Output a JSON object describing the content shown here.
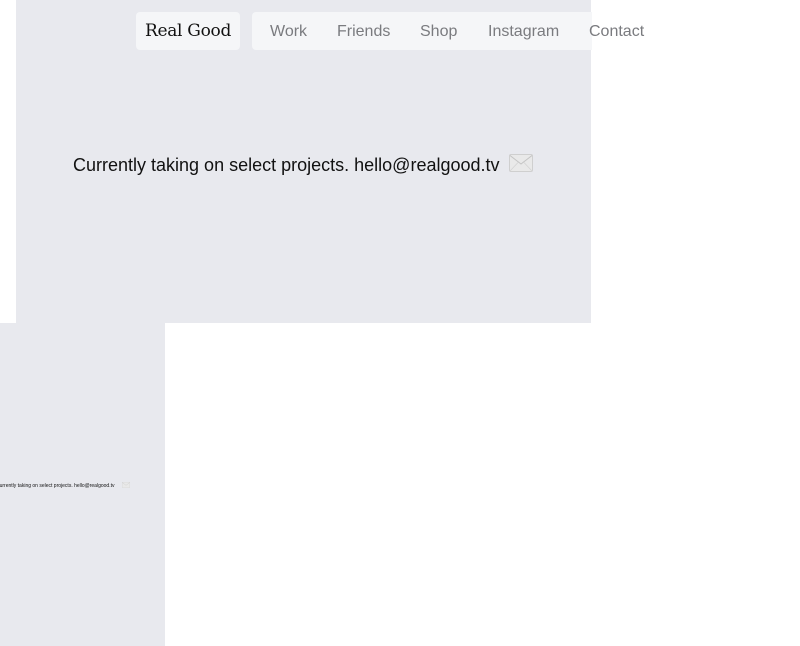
{
  "header": {
    "logo": "Real Good",
    "nav": [
      "Work",
      "Friends",
      "Shop",
      "Instagram",
      "Contact"
    ]
  },
  "main": {
    "message": "Currently taking on select projects.",
    "email": "hello@realgood.tv",
    "email_icon": "envelope-icon"
  },
  "mini": {
    "message": "Currently taking on select projects.",
    "email": "hello@realgood.tv",
    "email_icon": "envelope-icon"
  },
  "colors": {
    "panel_bg": "#e8e9ee",
    "nav_bg": "#f5f6f8",
    "nav_text": "#7a7b7f",
    "text": "#111111"
  }
}
